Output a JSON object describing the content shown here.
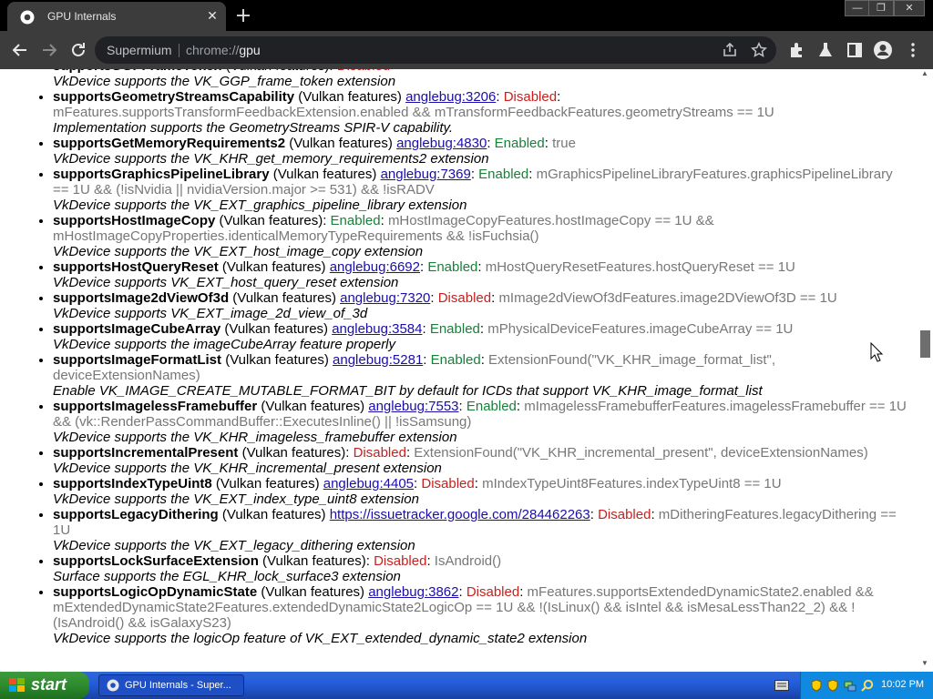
{
  "window": {
    "tab_title": "GPU Internals",
    "tab_close": "✕",
    "controls": {
      "minimize": "—",
      "maximize": "❐",
      "close": "✕"
    }
  },
  "toolbar": {
    "omnibox_label": "Supermium",
    "url_scheme": "chrome://",
    "url_host": "gpu"
  },
  "features": [
    {
      "name": "supportsGGPFrameToken",
      "label": " (Vulkan features): ",
      "bug": "",
      "status": "Disabled",
      "cond": "",
      "desc": "VkDevice supports the VK_GGP_frame_token extension"
    },
    {
      "name": "supportsGeometryStreamsCapability",
      "label": " (Vulkan features) ",
      "bug": "anglebug:3206",
      "status": "Disabled",
      "cond": "mFeatures.supportsTransformFeedbackExtension.enabled && mTransformFeedbackFeatures.geometryStreams == 1U",
      "desc": "Implementation supports the GeometryStreams SPIR-V capability."
    },
    {
      "name": "supportsGetMemoryRequirements2",
      "label": " (Vulkan features) ",
      "bug": "anglebug:4830",
      "status": "Enabled",
      "cond": "true",
      "desc": "VkDevice supports the VK_KHR_get_memory_requirements2 extension"
    },
    {
      "name": "supportsGraphicsPipelineLibrary",
      "label": " (Vulkan features) ",
      "bug": "anglebug:7369",
      "status": "Enabled",
      "cond": "mGraphicsPipelineLibraryFeatures.graphicsPipelineLibrary == 1U && (!isNvidia || nvidiaVersion.major >= 531) && !isRADV",
      "desc": "VkDevice supports the VK_EXT_graphics_pipeline_library extension"
    },
    {
      "name": "supportsHostImageCopy",
      "label": " (Vulkan features): ",
      "bug": "",
      "status": "Enabled",
      "cond": "mHostImageCopyFeatures.hostImageCopy == 1U && mHostImageCopyProperties.identicalMemoryTypeRequirements && !isFuchsia()",
      "desc": "VkDevice supports the VK_EXT_host_image_copy extension"
    },
    {
      "name": "supportsHostQueryReset",
      "label": " (Vulkan features) ",
      "bug": "anglebug:6692",
      "status": "Enabled",
      "cond": "mHostQueryResetFeatures.hostQueryReset == 1U",
      "desc": "VkDevice supports VK_EXT_host_query_reset extension"
    },
    {
      "name": "supportsImage2dViewOf3d",
      "label": " (Vulkan features) ",
      "bug": "anglebug:7320",
      "status": "Disabled",
      "cond": "mImage2dViewOf3dFeatures.image2DViewOf3D == 1U",
      "desc": "VkDevice supports VK_EXT_image_2d_view_of_3d"
    },
    {
      "name": "supportsImageCubeArray",
      "label": " (Vulkan features) ",
      "bug": "anglebug:3584",
      "status": "Enabled",
      "cond": "mPhysicalDeviceFeatures.imageCubeArray == 1U",
      "desc": "VkDevice supports the imageCubeArray feature properly"
    },
    {
      "name": "supportsImageFormatList",
      "label": " (Vulkan features) ",
      "bug": "anglebug:5281",
      "status": "Enabled",
      "cond": "ExtensionFound(\"VK_KHR_image_format_list\", deviceExtensionNames)",
      "desc": "Enable VK_IMAGE_CREATE_MUTABLE_FORMAT_BIT by default for ICDs that support VK_KHR_image_format_list"
    },
    {
      "name": "supportsImagelessFramebuffer",
      "label": " (Vulkan features) ",
      "bug": "anglebug:7553",
      "status": "Enabled",
      "cond": "mImagelessFramebufferFeatures.imagelessFramebuffer == 1U && (vk::RenderPassCommandBuffer::ExecutesInline() || !isSamsung)",
      "desc": "VkDevice supports the VK_KHR_imageless_framebuffer extension"
    },
    {
      "name": "supportsIncrementalPresent",
      "label": " (Vulkan features): ",
      "bug": "",
      "status": "Disabled",
      "cond": "ExtensionFound(\"VK_KHR_incremental_present\", deviceExtensionNames)",
      "desc": "VkDevice supports the VK_KHR_incremental_present extension"
    },
    {
      "name": "supportsIndexTypeUint8",
      "label": " (Vulkan features) ",
      "bug": "anglebug:4405",
      "status": "Disabled",
      "cond": "mIndexTypeUint8Features.indexTypeUint8 == 1U",
      "desc": "VkDevice supports the VK_EXT_index_type_uint8 extension"
    },
    {
      "name": "supportsLegacyDithering",
      "label": " (Vulkan features) ",
      "bug": "https://issuetracker.google.com/284462263",
      "status": "Disabled",
      "cond": "mDitheringFeatures.legacyDithering == 1U",
      "desc": "VkDevice supports the VK_EXT_legacy_dithering extension"
    },
    {
      "name": "supportsLockSurfaceExtension",
      "label": " (Vulkan features): ",
      "bug": "",
      "status": "Disabled",
      "cond": "IsAndroid()",
      "desc": "Surface supports the EGL_KHR_lock_surface3 extension"
    },
    {
      "name": "supportsLogicOpDynamicState",
      "label": " (Vulkan features) ",
      "bug": "anglebug:3862",
      "status": "Disabled",
      "cond": "mFeatures.supportsExtendedDynamicState2.enabled && mExtendedDynamicState2Features.extendedDynamicState2LogicOp == 1U && !(IsLinux() && isIntel && isMesaLessThan22_2) && !(IsAndroid() && isGalaxyS23)",
      "desc": "VkDevice supports the logicOp feature of VK_EXT_extended_dynamic_state2 extension"
    }
  ],
  "taskbar": {
    "start_label": "start",
    "task_label": "GPU Internals - Super...",
    "clock": "10:02 PM"
  },
  "colors": {
    "enabled": "#188038",
    "disabled": "#c5221f",
    "link": "#1a0dab",
    "condition": "#777777"
  },
  "icons": [
    "chrome-favicon",
    "close-icon",
    "new-tab-icon",
    "back-icon",
    "forward-icon",
    "reload-icon",
    "share-icon",
    "star-icon",
    "extensions-icon",
    "flask-icon",
    "sidepanel-icon",
    "profile-icon",
    "menu-icon",
    "windows-logo-icon",
    "keyboard-icon",
    "shield-icon",
    "network-icon",
    "search-icon"
  ]
}
